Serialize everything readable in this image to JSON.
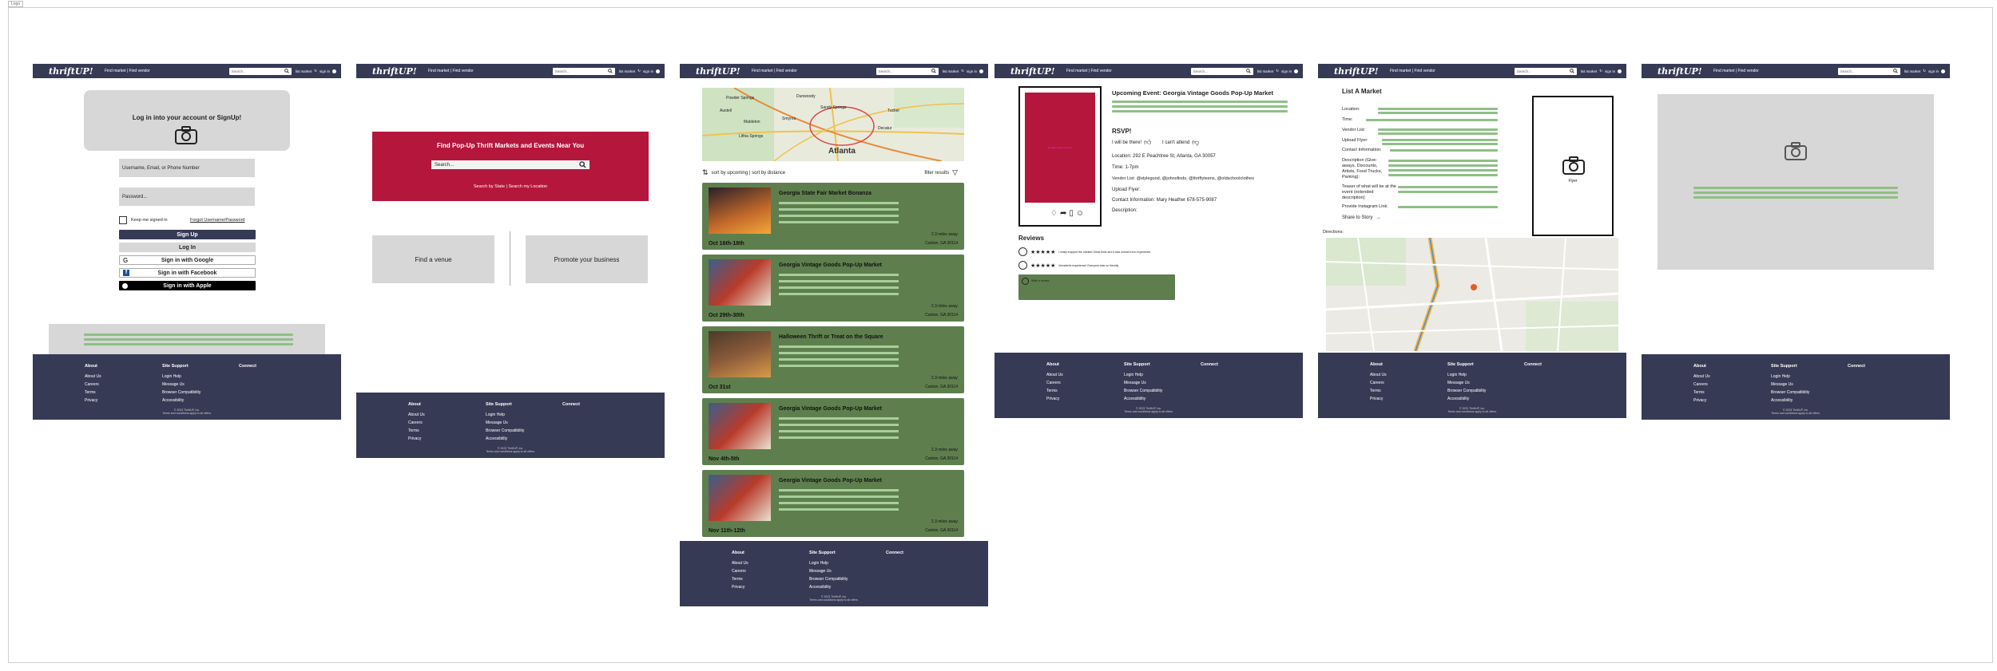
{
  "canvas_label": "Logo",
  "nav": {
    "logo": "thriftUP!",
    "links": "Find market | Find vendor",
    "search_placeholder": "Search...",
    "list_market": "list market",
    "sign_in": "sign in"
  },
  "footer": {
    "about_title": "About",
    "about_items": [
      "About Us",
      "Careers",
      "Terms",
      "Privacy"
    ],
    "support_title": "Site Support",
    "support_items": [
      "Login Help",
      "Message Us",
      "Browser Compatibility",
      "Accessibility"
    ],
    "connect_title": "Connect",
    "copyright": "© 2023 ThriftUP, Inc.",
    "terms": "Terms and conditions apply to all offers."
  },
  "login": {
    "heading": "Log in into your account or SignUp!",
    "username_placeholder": "Username, Email, or Phone Number",
    "password_placeholder": "Password...",
    "keep_signed_in": "Keep me signed in",
    "forgot": "Forgot Username/Password",
    "signup": "Sign Up",
    "login": "Log In",
    "google": "Sign in with Google",
    "facebook": "Sign in with Facebook",
    "apple": "Sign in with Apple"
  },
  "home": {
    "hero_title": "Find Pop-Up Thrift Markets and Events Near You",
    "search_placeholder": "Search...",
    "hero_links": "Search by State | Search my Location",
    "find_venue": "Find a venue",
    "promote": "Promote your business"
  },
  "results": {
    "sort_text": "sort by upcoming | sort by distance",
    "filter_text": "filter results",
    "map_labels": [
      "Smyrna",
      "Mableton",
      "Austell",
      "Atlanta",
      "Decatur",
      "Tucker",
      "Lithia Springs",
      "Powder Springs",
      "Sandy Springs",
      "Dunwoody"
    ],
    "cards": [
      {
        "title": "Georgia State Fair Market Bonanza",
        "date": "Oct 16th-18th",
        "distance": "2.3 miles away",
        "location": "Canton, GA 30114"
      },
      {
        "title": "Georgia Vintage Goods Pop-Up Market",
        "date": "Oct 29th-30th",
        "distance": "2.3 miles away",
        "location": "Canton, GA 30114"
      },
      {
        "title": "Halloween Thrift or Treat on the Square",
        "date": "Oct 31st",
        "distance": "2.3 miles away",
        "location": "Canton, GA 30114"
      },
      {
        "title": "Georgia Vintage Goods Pop-Up Market",
        "date": "Nov 4th-5th",
        "distance": "2.3 miles away",
        "location": "Canton, GA 30114"
      },
      {
        "title": "Georgia Vintage Goods Pop-Up Market",
        "date": "Nov 11th-12th",
        "distance": "2.3 miles away",
        "location": "Canton, GA 30114"
      }
    ]
  },
  "event": {
    "poster_text": "Vintage Goods Pop-Up",
    "title": "Upcoming Event: Georgia Vintage Goods Pop-Up Market",
    "rsvp": "RSVP!",
    "will_be_there": "I will be there!",
    "cant_attend": "I can't attend",
    "location": "Location: 292 E Peachtree St, Atlanta, GA 30057",
    "time": "Time: 1-7pm",
    "vendor_list": "Vendor List: @styleguod, @johnsfinds, @thriftyteens, @oldschoolclothes",
    "upload_flyer": "Upload Flyer:",
    "contact": "Contact Information: Mary Heather 678-575-9087",
    "description": "Description:",
    "reviews_title": "Reviews",
    "review1": "I really enjoyed the market! Great finds and it was overall a fun experience",
    "review2": "Wonderful experience! Everyone was so friendly",
    "reply_placeholder": "Write a review..."
  },
  "list_market": {
    "title": "List A Market",
    "fields": [
      "Location:",
      "Time:",
      "Vendor List:",
      "Upload Flyer:",
      "Contact Information:",
      "Description (Give-aways, Discounts, Artists, Food Trucks, Parking):",
      "Teaser of what will be at the event (extended description):",
      "Provide Instagram Link:"
    ],
    "share": "Share to Story",
    "directions": "Directions:",
    "flyer": "Flyer"
  }
}
